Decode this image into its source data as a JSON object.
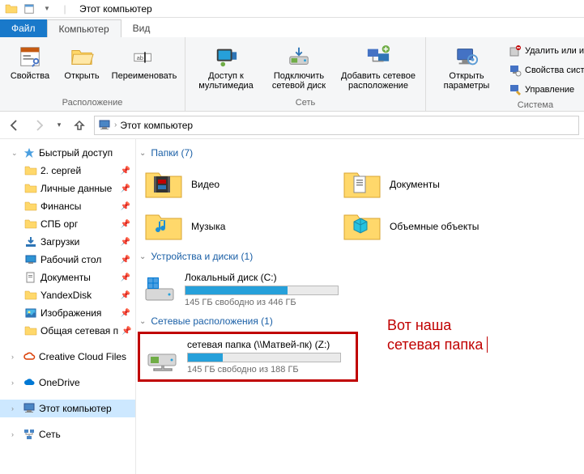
{
  "window": {
    "title": "Этот компьютер"
  },
  "tabs": {
    "file": "Файл",
    "computer": "Компьютер",
    "view": "Вид"
  },
  "ribbon": {
    "location": {
      "properties": "Свойства",
      "open": "Открыть",
      "rename": "Переименовать",
      "label": "Расположение"
    },
    "network": {
      "media": "Доступ к мультимедиа",
      "mapdrive": "Подключить сетевой диск",
      "addnet": "Добавить сетевое расположение",
      "label": "Сеть"
    },
    "system": {
      "settings": "Открыть параметры",
      "uninstall": "Удалить или изменить про",
      "sysprops": "Свойства системы",
      "manage": "Управление",
      "label": "Система"
    }
  },
  "address": {
    "root": "Этот компьютер"
  },
  "sidebar": {
    "quick": "Быстрый доступ",
    "items": [
      {
        "label": "2. сергей",
        "pin": true
      },
      {
        "label": "Личные данные",
        "pin": true
      },
      {
        "label": "Финансы",
        "pin": true
      },
      {
        "label": "СПБ орг",
        "pin": true
      },
      {
        "label": "Загрузки",
        "pin": true
      },
      {
        "label": "Рабочий стол",
        "pin": true
      },
      {
        "label": "Документы",
        "pin": true
      },
      {
        "label": "YandexDisk",
        "pin": true
      },
      {
        "label": "Изображения",
        "pin": true
      },
      {
        "label": "Общая сетевая п",
        "pin": true
      }
    ],
    "ccf": "Creative Cloud Files",
    "onedrive": "OneDrive",
    "thispc": "Этот компьютер",
    "network": "Сеть"
  },
  "groups": {
    "folders": {
      "title": "Папки (7)"
    },
    "drives": {
      "title": "Устройства и диски (1)"
    },
    "netloc": {
      "title": "Сетевые расположения (1)"
    }
  },
  "folders": [
    {
      "label": "Видео"
    },
    {
      "label": "Документы"
    },
    {
      "label": "Музыка"
    },
    {
      "label": "Объемные объекты"
    }
  ],
  "drives": {
    "local": {
      "title": "Локальный диск (C:)",
      "sub": "145 ГБ свободно из 446 ГБ",
      "fill_pct": 67
    },
    "network": {
      "title": "сетевая папка (\\\\Матвей-пк) (Z:)",
      "sub": "145 ГБ свободно из 188 ГБ",
      "fill_pct": 23
    }
  },
  "annotation": {
    "line1": "Вот наша",
    "line2": "сетевая папка"
  }
}
